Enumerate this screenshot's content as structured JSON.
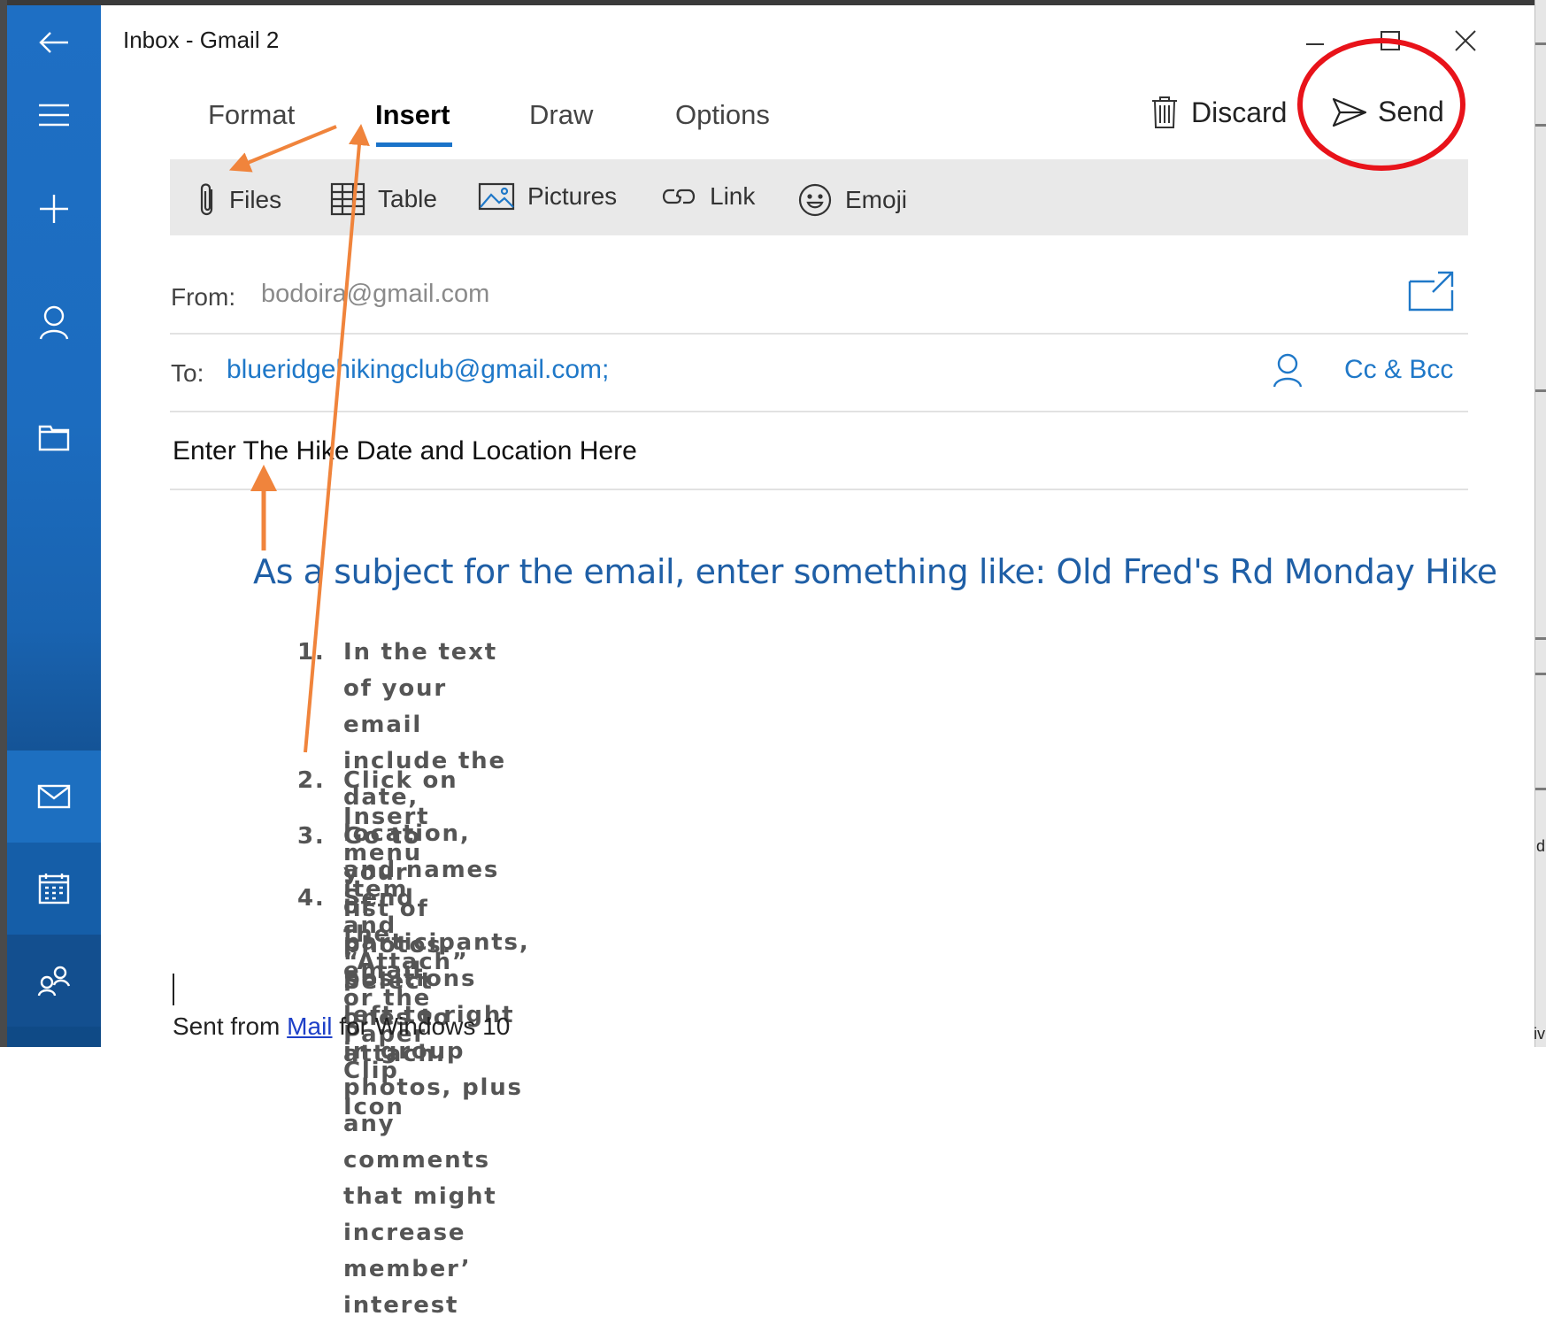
{
  "window": {
    "title": "Inbox - Gmail 2"
  },
  "sidebar": {
    "items": [
      {
        "icon": "back-arrow-icon"
      },
      {
        "icon": "hamburger-menu-icon"
      },
      {
        "icon": "plus-icon"
      },
      {
        "icon": "person-icon"
      },
      {
        "icon": "folder-icon"
      },
      {
        "icon": "mail-icon"
      },
      {
        "icon": "calendar-icon"
      },
      {
        "icon": "people-icon"
      }
    ]
  },
  "tabs": [
    {
      "label": "Format"
    },
    {
      "label": "Insert",
      "active": true
    },
    {
      "label": "Draw"
    },
    {
      "label": "Options"
    }
  ],
  "actions": {
    "discard_label": "Discard",
    "send_label": "Send"
  },
  "ribbon": {
    "files": "Files",
    "table": "Table",
    "pictures": "Pictures",
    "link": "Link",
    "emoji": "Emoji"
  },
  "compose": {
    "from_label": "From:",
    "from_value": "bodoira@gmail.com",
    "to_label": "To:",
    "to_value": "blueridgehikingclub@gmail.com;",
    "cc_bcc_label": "Cc & Bcc",
    "subject_value": "Enter The Hike Date and Location Here"
  },
  "body": {
    "headline": "As a subject for the email, enter something like: Old Fred's Rd Monday Hike",
    "steps": [
      {
        "num": "1.",
        "text": "In the text of your email include the date, location, and names of participants,\npositions left to right in group photos, plus any comments that might increase\nmember’ interest"
      },
      {
        "num": "2.",
        "text": "Click on Insert menu item and  “Attach” or the Paper Clip Icon"
      },
      {
        "num": "3.",
        "text": "Go to your list of photos. Select ones to attach."
      },
      {
        "num": "4.",
        "text": "Send the email"
      }
    ],
    "signature_prefix": "Sent from ",
    "signature_link": "Mail",
    "signature_suffix": " for Windows 10"
  },
  "background_edge": {
    "fragment_1": "d",
    "fragment_2": "iv"
  },
  "colors": {
    "accent": "#1f78c8",
    "sidebar": "#1c6cbf",
    "annotation_arrow": "#f0843c",
    "annotation_circle": "#e8131a"
  }
}
